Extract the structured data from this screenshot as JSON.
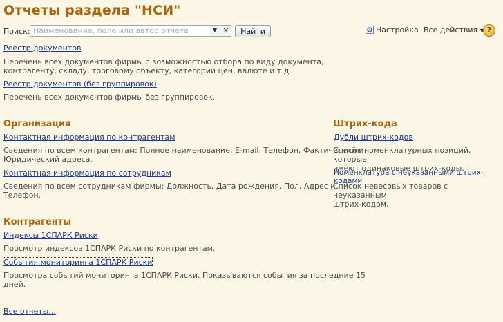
{
  "title": "Отчеты раздела \"НСИ\"",
  "search": {
    "label": "Поиск:",
    "placeholder": "Наименование, поле или автор отчета",
    "find_button": "Найти"
  },
  "toolbar": {
    "settings": "Настройка",
    "all_actions": "Все действия",
    "help": "?"
  },
  "top_reports": [
    {
      "link": "Реестр документов",
      "desc_lines": [
        "Перечень всех документов фирмы с возможностью отбора по виду документа,",
        "контрагенту, складу, торговому объекту, категории цен, валюте и т.д."
      ]
    },
    {
      "link": "Реестр документов (без группировок)",
      "desc_lines": [
        "Перечень всех документов фирмы без группировок."
      ]
    }
  ],
  "org": {
    "title": "Организация",
    "reports": [
      {
        "link": "Контактная информация по контрагентам",
        "desc_lines": [
          "Сведения по всем контрагентам: Полное наименование, E-mail, Телефон, Фактический и",
          "Юридический адреса."
        ]
      },
      {
        "link": "Контактная информация по сотрудникам",
        "desc_lines": [
          "Сведения по всем сотрудникам фирмы: Должность, Дата рождения, Пол, Адрес и",
          "Телефон."
        ]
      }
    ]
  },
  "barcodes": {
    "title": "Штрих-кода",
    "reports": [
      {
        "link": "Дубли штрих-кодов",
        "desc_lines": [
          "Список номенклатурных позиций, которые",
          "имеют одинаковые штрих-коды."
        ]
      },
      {
        "link": "Номенклатура с неуказанными штрих-кодами",
        "desc_lines": [
          "Список невесовых товаров с неуказанным",
          "штрих-кодом."
        ]
      }
    ]
  },
  "contractors": {
    "title": "Контрагенты",
    "reports": [
      {
        "link": "Индексы 1СПАРК Риски",
        "desc_lines": [
          "Просмотр индексов 1СПАРК Риски по контрагентам."
        ]
      },
      {
        "link": "События мониторинга 1СПАРК Риски",
        "desc_lines": [
          "Просмотра событий мониторинга 1СПАРК Риски. Показываются события за последние 15",
          "дней."
        ]
      }
    ]
  },
  "all_reports": "Все отчеты..."
}
